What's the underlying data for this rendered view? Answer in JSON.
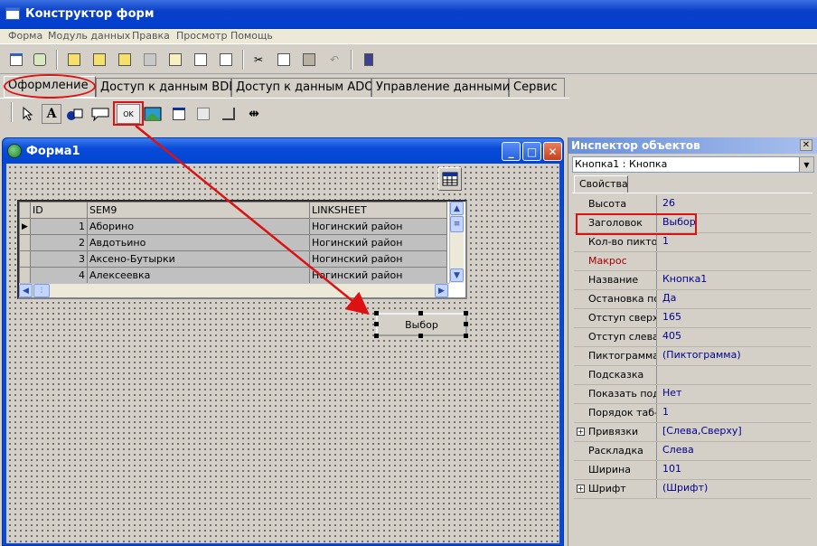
{
  "app": {
    "title": "Конструктор форм"
  },
  "menu": [
    "Форма",
    "Модуль данных",
    "Правка",
    "Просмотр",
    "Помощь"
  ],
  "toolbar_icons": [
    "new-form-icon",
    "database-icon",
    "open-icon",
    "open-icon",
    "folder-icon",
    "save-icon",
    "copy-form-icon",
    "layers-icon",
    "checklist-icon",
    "cut-icon",
    "copy-icon",
    "paste-icon",
    "undo-icon",
    "run-icon"
  ],
  "tabs": [
    "Оформление",
    "Доступ к данным BDE",
    "Доступ к данным ADO",
    "Управление данными",
    "Сервис"
  ],
  "palette_icons": [
    "pointer-icon",
    "label-icon",
    "shapes-icon",
    "callout-icon",
    "button-ok-icon",
    "image-icon",
    "panel-icon",
    "frame-icon",
    "corner-icon",
    "splitter-icon"
  ],
  "palette_button_text": "OK",
  "form": {
    "title": "Форма1",
    "grid": {
      "columns": [
        "ID",
        "SEM9",
        "LINKSHEET"
      ],
      "rows": [
        [
          "1",
          "Аборино",
          "Ногинский район"
        ],
        [
          "2",
          "Авдотьино",
          "Ногинский район"
        ],
        [
          "3",
          "Аксено-Бутырки",
          "Ногинский район"
        ],
        [
          "4",
          "Алексеевка",
          "Ногинский район"
        ]
      ]
    },
    "button_label": "Выбор"
  },
  "inspector": {
    "title": "Инспектор объектов",
    "object": "Кнопка1 : Кнопка",
    "tab": "Свойства",
    "properties": [
      {
        "name": "Высота",
        "value": "26"
      },
      {
        "name": "Заголовок",
        "value": "Выбор"
      },
      {
        "name": "Кол-во пиктогр",
        "value": "1"
      },
      {
        "name": "Макрос",
        "value": ""
      },
      {
        "name": "Название",
        "value": "Кнопка1"
      },
      {
        "name": "Остановка по Т",
        "value": "Да"
      },
      {
        "name": "Отступ сверху",
        "value": "165"
      },
      {
        "name": "Отступ слева",
        "value": "405"
      },
      {
        "name": "Пиктограмма",
        "value": "(Пиктограмма)"
      },
      {
        "name": "Подсказка",
        "value": ""
      },
      {
        "name": "Показать подс",
        "value": "Нет"
      },
      {
        "name": "Порядок таб-щ",
        "value": "1"
      },
      {
        "name": "Привязки",
        "value": "[Слева,Сверху]"
      },
      {
        "name": "Раскладка",
        "value": "Слева"
      },
      {
        "name": "Ширина",
        "value": "101"
      },
      {
        "name": "Шрифт",
        "value": "(Шрифт)"
      }
    ]
  },
  "colors": {
    "title_bar": "#0a3fc7",
    "annotation": "#d11111"
  }
}
